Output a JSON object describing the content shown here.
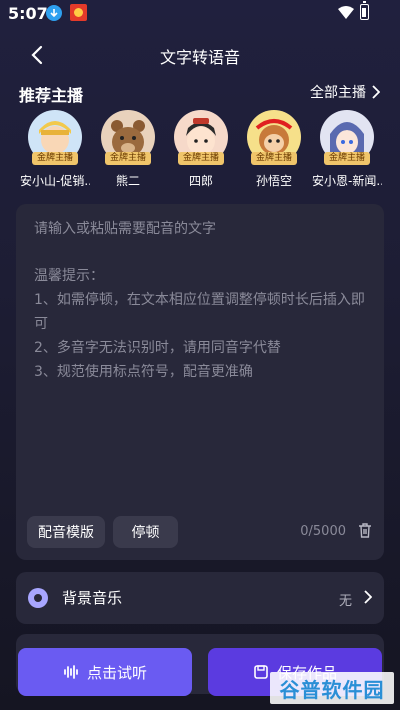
{
  "status_bar": {
    "time": "5:07"
  },
  "nav": {
    "title": "文字转语音"
  },
  "anchors_section": {
    "title": "推荐主播",
    "all_label": "全部主播",
    "items": [
      {
        "name": "安小山-促销...",
        "badge": "金牌主播",
        "bg": "#cfe4f7"
      },
      {
        "name": "熊二",
        "badge": "金牌主播",
        "bg": "#e9d2bc"
      },
      {
        "name": "四郎",
        "badge": "金牌主播",
        "bg": "#f6d9c9"
      },
      {
        "name": "孙悟空",
        "badge": "金牌主播",
        "bg": "#f6e08a"
      },
      {
        "name": "安小恩-新闻...",
        "badge": "金牌主播",
        "bg": "#e2e4f2"
      }
    ]
  },
  "editor": {
    "placeholder": "请输入或粘贴需要配音的文字",
    "tips": [
      "温馨提示：",
      "1、如需停顿，在文本相应位置调整停顿时长后插入即可",
      "2、多音字无法识别时，请用同音字代替",
      "3、规范使用标点符号，配音更准确"
    ],
    "template_button": "配音模版",
    "pause_button": "停顿",
    "counter": "0/5000"
  },
  "bgm": {
    "label": "背景音乐",
    "value": "无"
  },
  "actions": {
    "listen": "点击试听",
    "save": "保存作品"
  },
  "watermark": "谷普软件园",
  "colors": {
    "accent_listen": "#6a5bf2",
    "accent_save": "#5b3be0",
    "badge": "#f0c56a"
  }
}
